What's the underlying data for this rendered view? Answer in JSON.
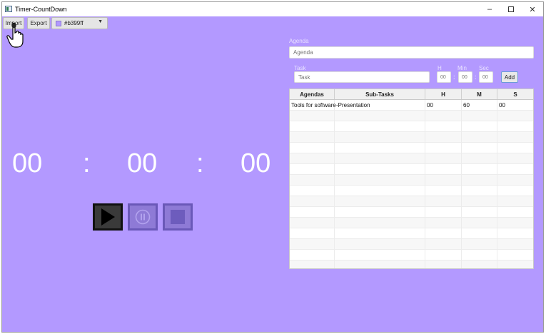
{
  "window": {
    "title": "Timer-CountDown"
  },
  "controls": {
    "minimize": "–",
    "maximize": "□",
    "close": "✕"
  },
  "toolbar": {
    "import_label": "Import",
    "export_label": "Export",
    "color_value": "#b399ff"
  },
  "timer": {
    "hours": "00",
    "separator": ":",
    "minutes": "00",
    "seconds": "00"
  },
  "agenda": {
    "label": "Agenda",
    "placeholder": "Agenda"
  },
  "task": {
    "label": "Task",
    "placeholder": "Task",
    "h_label": "H",
    "min_label": "Min",
    "sec_label": "Sec",
    "h_placeholder": "00",
    "min_placeholder": "00",
    "sec_placeholder": "00",
    "add_label": "Add"
  },
  "table": {
    "headers": [
      "Agendas",
      "Sub-Tasks",
      "H",
      "M",
      "S"
    ],
    "rows": [
      {
        "agenda": "Tools for software",
        "subtask": "-Presentation",
        "h": "00",
        "m": "60",
        "s": "00"
      }
    ]
  },
  "colors": {
    "background": "#b399ff",
    "play_active": "#111111"
  }
}
